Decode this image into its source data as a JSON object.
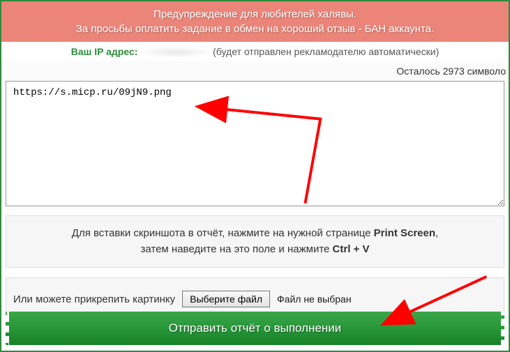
{
  "warning": {
    "line1": "Предупреждение для любителей халявы.",
    "line2": "За просьбы оплатить задание в обмен на хороший отзыв - БАН аккаунта."
  },
  "ip": {
    "label": "Ваш IP адрес:",
    "note": "(будет отправлен рекламодателю автоматически)"
  },
  "counter": {
    "text": "Осталось 2973 символо"
  },
  "textarea": {
    "value": "https://s.micp.ru/09jN9.png"
  },
  "hint": {
    "part1": "Для вставки скриншота в отчёт, нажмите на нужной странице ",
    "printscreen": "Print Screen",
    "part2": ",",
    "part3": "затем наведите на это поле и нажмите ",
    "ctrlv": "Ctrl + V"
  },
  "attach": {
    "label": "Или можете прикрепить картинку",
    "button": "Выберите файл",
    "no_file": "Файл не выбран"
  },
  "submit": {
    "label": "Отправить отчёт о выполнении"
  }
}
